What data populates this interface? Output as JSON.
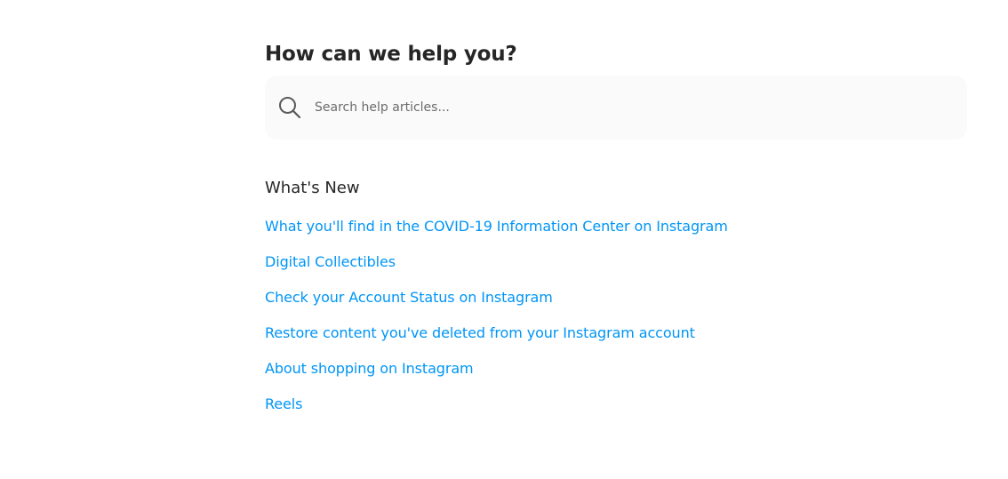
{
  "header": {
    "title": "How can we help you?"
  },
  "search": {
    "placeholder": "Search help articles...",
    "value": "",
    "icon": "search-icon"
  },
  "whats_new": {
    "title": "What's New",
    "articles": [
      {
        "label": "What you'll find in the COVID-19 Information Center on Instagram"
      },
      {
        "label": "Digital Collectibles"
      },
      {
        "label": "Check your Account Status on Instagram"
      },
      {
        "label": "Restore content you've deleted from your Instagram account"
      },
      {
        "label": "About shopping on Instagram"
      },
      {
        "label": "Reels"
      }
    ]
  },
  "colors": {
    "link": "#0095f6",
    "text": "#262626",
    "search_bg": "#fafafa",
    "placeholder": "#6b6b6b"
  }
}
